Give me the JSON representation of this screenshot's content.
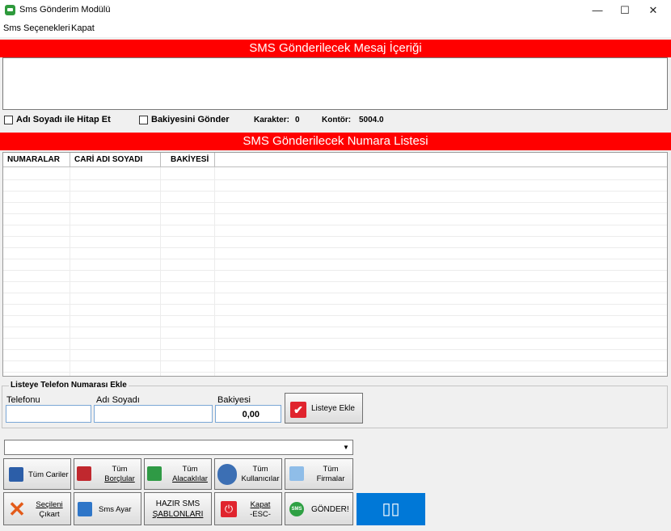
{
  "window": {
    "title": "Sms Gönderim Modülü",
    "minimize": "—",
    "maximize": "☐",
    "close": "✕"
  },
  "menu": [
    {
      "label": "Sms Seçenekleri"
    },
    {
      "label": "Kapat"
    }
  ],
  "message_section": {
    "title": "SMS Gönderilecek Mesaj İçeriği",
    "message_text": ""
  },
  "options": {
    "hitap_label": "Adı Soyadı ile Hitap Et",
    "bakiye_label": "Bakiyesini Gönder",
    "karakter_label": "Karakter:",
    "karakter_value": "0",
    "kontor_label": "Kontör:",
    "kontor_value": "5004.0"
  },
  "number_section": {
    "title": "SMS Gönderilecek Numara Listesi",
    "columns": [
      "NUMARALAR",
      "CARİ ADI SOYADI",
      "BAKİYESİ"
    ]
  },
  "add_group": {
    "title": "Listeye Telefon Numarası Ekle",
    "phone_label": "Telefonu",
    "name_label": "Adı Soyadı",
    "balance_label": "Bakiyesi",
    "phone_value": "",
    "name_value": "",
    "balance_value": "0,00",
    "add_button": "Listeye Ekle"
  },
  "combo": {
    "value": ""
  },
  "buttons": {
    "tum_cariler": "Tüm Cariler",
    "tum_borclular": [
      "Tüm",
      "Borçlular"
    ],
    "tum_alacaklilar": [
      "Tüm",
      "Alacaklılar"
    ],
    "tum_kullanicilar": [
      "Tüm",
      "Kullanıcılar"
    ],
    "tum_firmalar": [
      "Tüm",
      "Firmalar"
    ],
    "secileni_cikart": [
      "Seçileni",
      "Çıkart"
    ],
    "sms_ayar": "Sms Ayar",
    "hazir_sablonlar": [
      "HAZIR SMS",
      "ŞABLONLARI"
    ],
    "kapat": [
      "Kapat",
      "-ESC-"
    ],
    "gonder": "GÖNDER!"
  },
  "blue_box": {
    "text": "▯▯"
  },
  "colors": {
    "header_red": "#ff0000",
    "accent_blue": "#0078d7",
    "check_red": "#e0242e"
  }
}
